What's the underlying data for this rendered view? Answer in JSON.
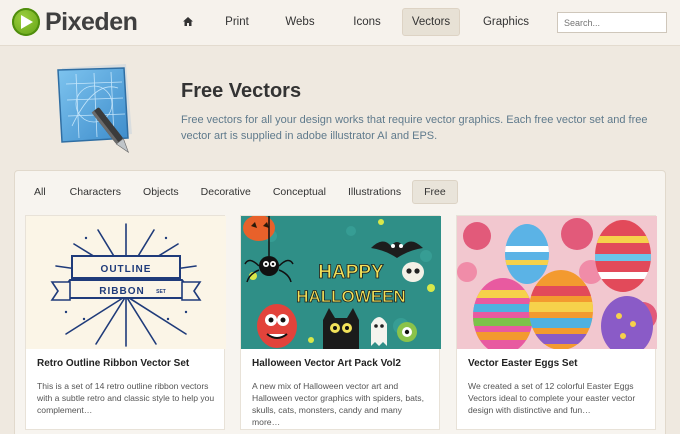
{
  "header": {
    "logo_text": "Pixeden",
    "nav": [
      {
        "label": "",
        "icon": "home-icon"
      },
      {
        "label": "Print"
      },
      {
        "label": "Webs"
      },
      {
        "label": "Icons"
      },
      {
        "label": "Vectors",
        "active": true
      },
      {
        "label": "Graphics"
      }
    ],
    "search_placeholder": "Search..."
  },
  "hero": {
    "title": "Free Vectors",
    "description": "Free vectors for all your design works that require vector graphics. Each free vector set and free vector art is supplied in adobe illustrator AI and EPS."
  },
  "filters": [
    {
      "label": "All"
    },
    {
      "label": "Characters"
    },
    {
      "label": "Objects"
    },
    {
      "label": "Decorative"
    },
    {
      "label": "Conceptual"
    },
    {
      "label": "Illustrations"
    },
    {
      "label": "Free",
      "active": true
    }
  ],
  "cards": [
    {
      "title": "Retro Outline Ribbon Vector Set",
      "description": "This is a set of 14 retro outline ribbon vectors with a subtle retro and classic style to help you complement…",
      "image_text": {
        "line1": "OUTLINE",
        "line2": "RIBBON",
        "line3": "SET"
      }
    },
    {
      "title": "Halloween Vector Art Pack Vol2",
      "description": "A new mix of Halloween vector art and Halloween vector graphics with spiders, bats, skulls, cats, monsters, candy and many more…",
      "image_text": {
        "line1": "HAPPY",
        "line2": "HALLOWEEN"
      }
    },
    {
      "title": "Vector Easter Eggs Set",
      "description": "We created a set of 12 colorful Easter Eggs Vectors ideal to complete your easter vector design with distinctive and fun…"
    }
  ],
  "colors": {
    "background": "#efe9e0",
    "accent_green": "#6aab1c",
    "description_blue": "#5f7a8c",
    "halloween_bg": "#2f8f87",
    "ribbon_navy": "#1f3b7a"
  }
}
